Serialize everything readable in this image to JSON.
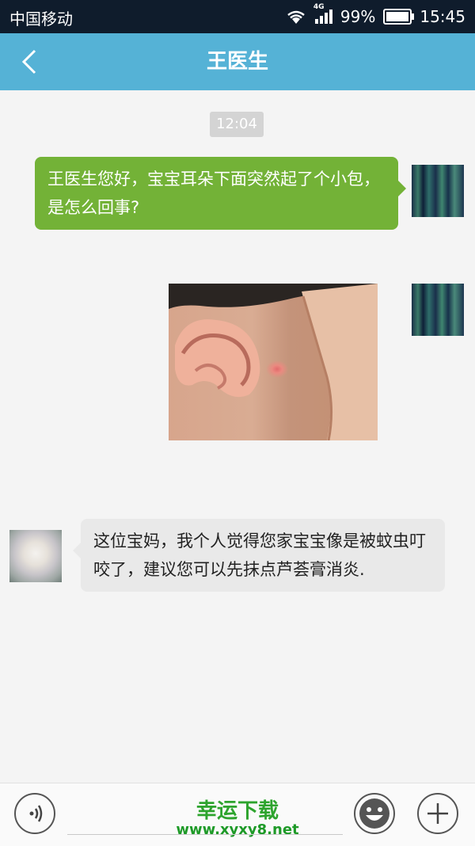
{
  "status_bar": {
    "carrier": "中国移动",
    "network": "4G",
    "battery_text": "99%",
    "battery_level": 0.99,
    "time": "15:45",
    "background": "#0f1c2c"
  },
  "header": {
    "title": "王医生",
    "back_icon": "chevron-left-icon",
    "background": "#55b2d6"
  },
  "chat": {
    "timestamp": "12:04",
    "messages": [
      {
        "sender": "self",
        "type": "text",
        "text": "王医生您好，宝宝耳朵下面突然起了个小包，是怎么回事?"
      },
      {
        "sender": "self",
        "type": "image"
      },
      {
        "sender": "doctor",
        "type": "text",
        "text": "这位宝妈，我个人觉得您家宝宝像是被蚊虫叮咬了，建议您可以先抹点芦荟膏消炎."
      }
    ],
    "outgoing_bubble_color": "#73b237",
    "incoming_bubble_color": "#e9e9e9"
  },
  "input_bar": {
    "voice_icon": "voice-icon",
    "emoji_icon": "smiley-icon",
    "more_icon": "plus-icon"
  },
  "watermark": {
    "title": "幸运下载",
    "url": "www.xyxy8.net",
    "color": "#2ea42e"
  }
}
